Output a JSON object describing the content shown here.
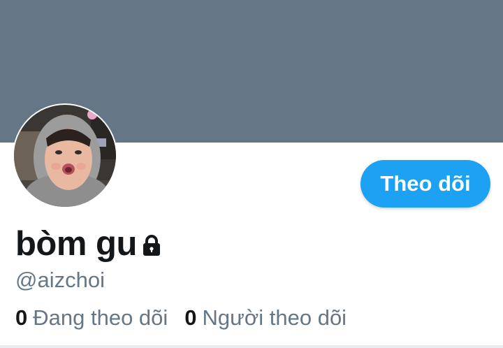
{
  "profile": {
    "display_name": "bòm gu",
    "handle": "@aizchoi",
    "protected": true,
    "follow_button_label": "Theo dõi",
    "following_count": "0",
    "following_label": "Đang theo dõi",
    "followers_count": "0",
    "followers_label": "Người theo dõi"
  },
  "icons": {
    "lock": "lock-icon",
    "avatar": "avatar"
  },
  "colors": {
    "banner": "#657786",
    "accent": "#1da1f2",
    "text_primary": "#14171a",
    "text_secondary": "#657786"
  }
}
